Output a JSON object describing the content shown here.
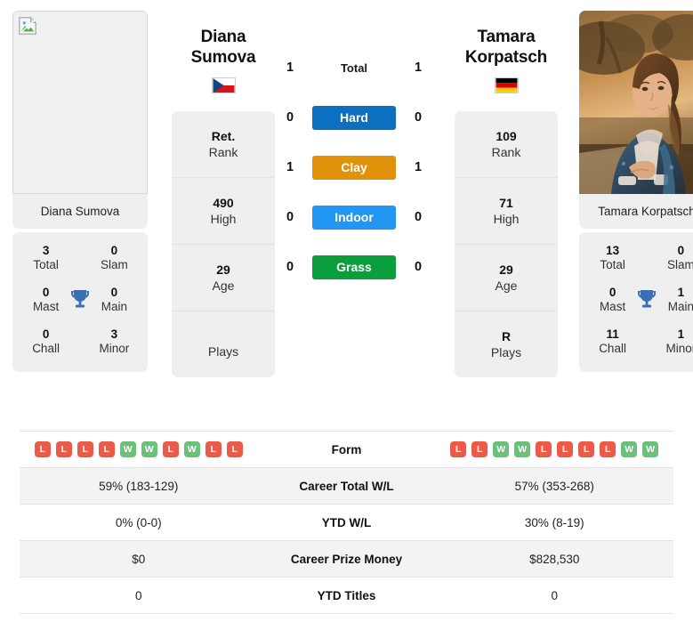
{
  "players": {
    "left": {
      "first_name": "Diana",
      "last_name": "Sumova",
      "full_name": "Diana Sumova",
      "country": "Czech Republic",
      "flag": "cz",
      "photo": "broken-image",
      "rank": "Ret.",
      "rank_label": "Rank",
      "high": "490",
      "high_label": "High",
      "age": "29",
      "age_label": "Age",
      "plays": "",
      "plays_label": "Plays",
      "titles": {
        "total": "3",
        "total_label": "Total",
        "slam": "0",
        "slam_label": "Slam",
        "mast": "0",
        "mast_label": "Mast",
        "main": "0",
        "main_label": "Main",
        "chall": "0",
        "chall_label": "Chall",
        "minor": "3",
        "minor_label": "Minor"
      },
      "form": [
        "L",
        "L",
        "L",
        "L",
        "W",
        "W",
        "L",
        "W",
        "L",
        "L"
      ],
      "career_total_wl": "59% (183-129)",
      "ytd_wl": "0% (0-0)",
      "career_prize_money": "$0",
      "ytd_titles": "0"
    },
    "right": {
      "first_name": "Tamara",
      "last_name": "Korpatsch",
      "full_name": "Tamara Korpatsch",
      "country": "Germany",
      "flag": "de",
      "photo": "portrait-photo",
      "rank": "109",
      "rank_label": "Rank",
      "high": "71",
      "high_label": "High",
      "age": "29",
      "age_label": "Age",
      "plays": "R",
      "plays_label": "Plays",
      "titles": {
        "total": "13",
        "total_label": "Total",
        "slam": "0",
        "slam_label": "Slam",
        "mast": "0",
        "mast_label": "Mast",
        "main": "1",
        "main_label": "Main",
        "chall": "11",
        "chall_label": "Chall",
        "minor": "1",
        "minor_label": "Minor"
      },
      "form": [
        "L",
        "L",
        "W",
        "W",
        "L",
        "L",
        "L",
        "L",
        "W",
        "W"
      ],
      "career_total_wl": "57% (353-268)",
      "ytd_wl": "30% (8-19)",
      "career_prize_money": "$828,530",
      "ytd_titles": "0"
    }
  },
  "h2h": {
    "rows": [
      {
        "label": "Total",
        "left": "1",
        "right": "1",
        "pill": false,
        "color": ""
      },
      {
        "label": "Hard",
        "left": "0",
        "right": "0",
        "pill": true,
        "color": "#0c6fbf"
      },
      {
        "label": "Clay",
        "left": "1",
        "right": "1",
        "pill": true,
        "color": "#df920a"
      },
      {
        "label": "Indoor",
        "left": "0",
        "right": "0",
        "pill": true,
        "color": "#2196f3"
      },
      {
        "label": "Grass",
        "left": "0",
        "right": "0",
        "pill": true,
        "color": "#0a9f3c"
      }
    ]
  },
  "stats_table": {
    "rows": [
      {
        "label": "Form",
        "type": "form",
        "left": "",
        "right": ""
      },
      {
        "label": "Career Total W/L",
        "type": "text",
        "left": "59% (183-129)",
        "right": "57% (353-268)"
      },
      {
        "label": "YTD W/L",
        "type": "text",
        "left": "0% (0-0)",
        "right": "30% (8-19)"
      },
      {
        "label": "Career Prize Money",
        "type": "text",
        "left": "$0",
        "right": "$828,530"
      },
      {
        "label": "YTD Titles",
        "type": "text",
        "left": "0",
        "right": "0"
      }
    ]
  },
  "icons": {
    "trophy": "trophy-icon",
    "broken_image": "broken-image-icon"
  },
  "colors": {
    "win": "#6dc07a",
    "loss": "#ec5b47",
    "hard": "#0c6fbf",
    "clay": "#df920a",
    "indoor": "#2196f3",
    "grass": "#0a9f3c",
    "card_bg": "#efefef",
    "row_alt_bg": "#f3f3f3"
  }
}
